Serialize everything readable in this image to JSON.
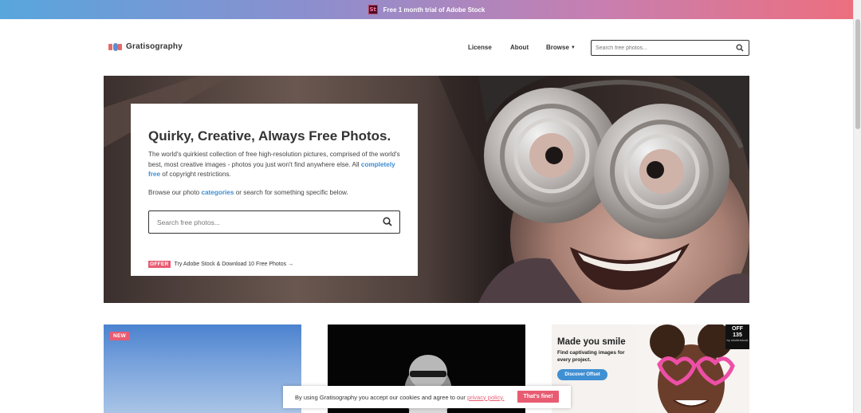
{
  "promo": {
    "logo_text": "St",
    "text": "Free 1 month trial of Adobe Stock"
  },
  "header": {
    "brand": "Gratisography",
    "nav": {
      "license": "License",
      "about": "About",
      "browse": "Browse"
    },
    "search_placeholder": "Search free photos..."
  },
  "hero": {
    "title": "Quirky, Creative, Always Free Photos.",
    "desc_before": "The world's quirkiest collection of free high-resolution pictures, comprised of the world's best, most creative images - photos you just won't find anywhere else. All ",
    "desc_link": "completely free",
    "desc_after": " of copyright restrictions.",
    "browse_before": "Browse our photo ",
    "browse_link": "categories",
    "browse_after": " or search for something specific below.",
    "search_placeholder": "Search free photos...",
    "offer_badge": "OFFER",
    "offer_text": "Try Adobe Stock & Download 10 Free Photos →"
  },
  "cards": {
    "new_badge": "NEW",
    "ad": {
      "title": "Made you smile",
      "subtitle": "Find captivating images for every project.",
      "button": "Discover Offset",
      "corner_line1": "OFF",
      "corner_line2": "135",
      "corner_line3": "by shutterstock"
    }
  },
  "cookie": {
    "text": "By using Gratisography you accept our cookies and agree to our ",
    "link": "privacy policy.",
    "button": "That's fine!"
  },
  "colors": {
    "accent_pink": "#e85c72",
    "link_blue": "#3d8ed3"
  }
}
